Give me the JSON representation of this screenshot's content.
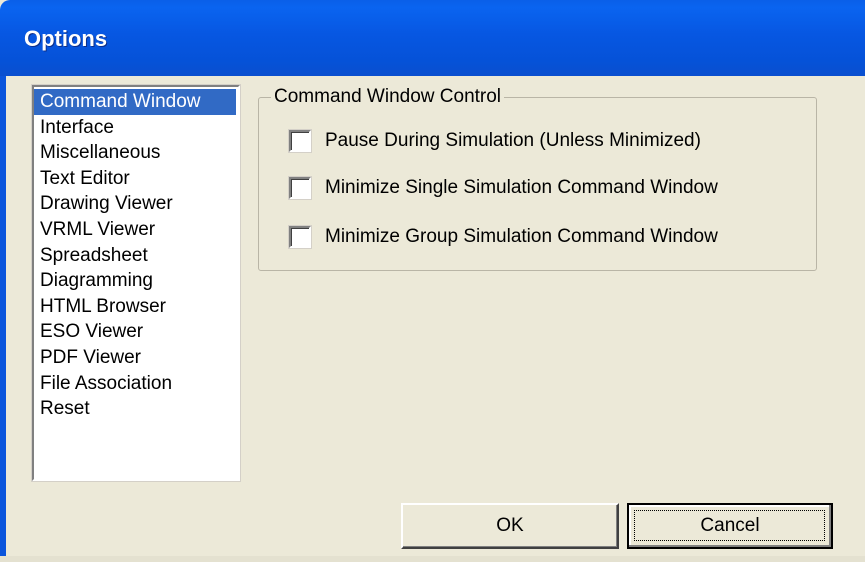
{
  "window": {
    "title": "Options"
  },
  "categories": [
    {
      "label": "Command Window",
      "selected": true
    },
    {
      "label": "Interface",
      "selected": false
    },
    {
      "label": "Miscellaneous",
      "selected": false
    },
    {
      "label": "Text Editor",
      "selected": false
    },
    {
      "label": "Drawing Viewer",
      "selected": false
    },
    {
      "label": "VRML Viewer",
      "selected": false
    },
    {
      "label": "Spreadsheet",
      "selected": false
    },
    {
      "label": "Diagramming",
      "selected": false
    },
    {
      "label": "HTML Browser",
      "selected": false
    },
    {
      "label": "ESO Viewer",
      "selected": false
    },
    {
      "label": "PDF Viewer",
      "selected": false
    },
    {
      "label": "File Association",
      "selected": false
    },
    {
      "label": "Reset",
      "selected": false
    }
  ],
  "command_window_control": {
    "legend": "Command Window Control",
    "options": [
      {
        "label": "Pause During Simulation (Unless Minimized)",
        "checked": false
      },
      {
        "label": "Minimize Single Simulation Command Window",
        "checked": false
      },
      {
        "label": "Minimize Group Simulation Command Window",
        "checked": false
      }
    ]
  },
  "buttons": {
    "ok_label": "OK",
    "cancel_label": "Cancel"
  },
  "colors": {
    "titlebar": "#0757e2",
    "selection": "#316ac5",
    "dialog_face": "#ece9d8"
  }
}
